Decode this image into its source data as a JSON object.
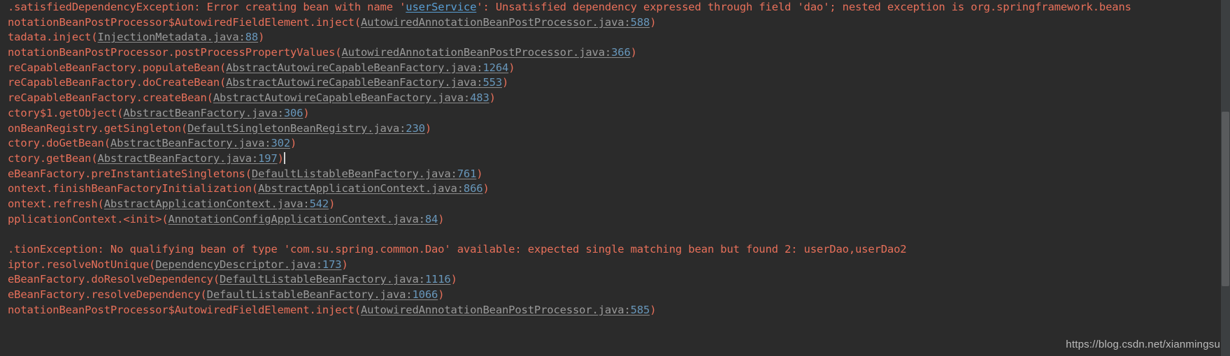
{
  "console": {
    "background_color": "#2b2b2b",
    "error_text_color": "#e8705a",
    "file_link_color": "#9a9a9a",
    "line_number_color": "#6897bb",
    "hyperlink_color": "#5a9fd4",
    "lines": [
      {
        "id": "line-1",
        "type": "exception-header",
        "segments": [
          {
            "kind": "msg",
            "text": ".satisfiedDependencyException: Error creating bean with name '"
          },
          {
            "kind": "weblink",
            "text": "userService"
          },
          {
            "kind": "msg",
            "text": "': Unsatisfied dependency expressed through field 'dao'; nested exception is org.springframework.beans"
          }
        ]
      },
      {
        "id": "line-2",
        "type": "stack-frame",
        "segments": [
          {
            "kind": "msg",
            "text": "notationBeanPostProcessor$AutowiredFieldElement.inject("
          },
          {
            "kind": "lnk",
            "text": "AutowiredAnnotationBeanPostProcessor.java:"
          },
          {
            "kind": "num",
            "text": "588"
          },
          {
            "kind": "paren",
            "text": ")"
          }
        ]
      },
      {
        "id": "line-3",
        "type": "stack-frame",
        "segments": [
          {
            "kind": "msg",
            "text": "tadata.inject("
          },
          {
            "kind": "lnk",
            "text": "InjectionMetadata.java:"
          },
          {
            "kind": "num",
            "text": "88"
          },
          {
            "kind": "paren",
            "text": ")"
          }
        ]
      },
      {
        "id": "line-4",
        "type": "stack-frame",
        "segments": [
          {
            "kind": "msg",
            "text": "notationBeanPostProcessor.postProcessPropertyValues("
          },
          {
            "kind": "lnk",
            "text": "AutowiredAnnotationBeanPostProcessor.java:"
          },
          {
            "kind": "num",
            "text": "366"
          },
          {
            "kind": "paren",
            "text": ")"
          }
        ]
      },
      {
        "id": "line-5",
        "type": "stack-frame",
        "segments": [
          {
            "kind": "msg",
            "text": "reCapableBeanFactory.populateBean("
          },
          {
            "kind": "lnk",
            "text": "AbstractAutowireCapableBeanFactory.java:"
          },
          {
            "kind": "num",
            "text": "1264"
          },
          {
            "kind": "paren",
            "text": ")"
          }
        ]
      },
      {
        "id": "line-6",
        "type": "stack-frame",
        "segments": [
          {
            "kind": "msg",
            "text": "reCapableBeanFactory.doCreateBean("
          },
          {
            "kind": "lnk",
            "text": "AbstractAutowireCapableBeanFactory.java:"
          },
          {
            "kind": "num",
            "text": "553"
          },
          {
            "kind": "paren",
            "text": ")"
          }
        ]
      },
      {
        "id": "line-7",
        "type": "stack-frame",
        "segments": [
          {
            "kind": "msg",
            "text": "reCapableBeanFactory.createBean("
          },
          {
            "kind": "lnk",
            "text": "AbstractAutowireCapableBeanFactory.java:"
          },
          {
            "kind": "num",
            "text": "483"
          },
          {
            "kind": "paren",
            "text": ")"
          }
        ]
      },
      {
        "id": "line-8",
        "type": "stack-frame",
        "segments": [
          {
            "kind": "msg",
            "text": "ctory$1.getObject("
          },
          {
            "kind": "lnk",
            "text": "AbstractBeanFactory.java:"
          },
          {
            "kind": "num",
            "text": "306"
          },
          {
            "kind": "paren",
            "text": ")"
          }
        ]
      },
      {
        "id": "line-9",
        "type": "stack-frame",
        "segments": [
          {
            "kind": "msg",
            "text": "onBeanRegistry.getSingleton("
          },
          {
            "kind": "lnk",
            "text": "DefaultSingletonBeanRegistry.java:"
          },
          {
            "kind": "num",
            "text": "230"
          },
          {
            "kind": "paren",
            "text": ")"
          }
        ]
      },
      {
        "id": "line-10",
        "type": "stack-frame",
        "segments": [
          {
            "kind": "msg",
            "text": "ctory.doGetBean("
          },
          {
            "kind": "lnk",
            "text": "AbstractBeanFactory.java:"
          },
          {
            "kind": "num",
            "text": "302"
          },
          {
            "kind": "paren",
            "text": ")"
          }
        ]
      },
      {
        "id": "line-11",
        "type": "stack-frame",
        "has_caret": true,
        "segments": [
          {
            "kind": "msg",
            "text": "ctory.getBean("
          },
          {
            "kind": "lnk",
            "text": "AbstractBeanFactory.java:"
          },
          {
            "kind": "num",
            "text": "197"
          },
          {
            "kind": "paren",
            "text": ")"
          }
        ]
      },
      {
        "id": "line-12",
        "type": "stack-frame",
        "segments": [
          {
            "kind": "msg",
            "text": "eBeanFactory.preInstantiateSingletons("
          },
          {
            "kind": "lnk",
            "text": "DefaultListableBeanFactory.java:"
          },
          {
            "kind": "num",
            "text": "761"
          },
          {
            "kind": "paren",
            "text": ")"
          }
        ]
      },
      {
        "id": "line-13",
        "type": "stack-frame",
        "segments": [
          {
            "kind": "msg",
            "text": "ontext.finishBeanFactoryInitialization("
          },
          {
            "kind": "lnk",
            "text": "AbstractApplicationContext.java:"
          },
          {
            "kind": "num",
            "text": "866"
          },
          {
            "kind": "paren",
            "text": ")"
          }
        ]
      },
      {
        "id": "line-14",
        "type": "stack-frame",
        "segments": [
          {
            "kind": "msg",
            "text": "ontext.refresh("
          },
          {
            "kind": "lnk",
            "text": "AbstractApplicationContext.java:"
          },
          {
            "kind": "num",
            "text": "542"
          },
          {
            "kind": "paren",
            "text": ")"
          }
        ]
      },
      {
        "id": "line-15",
        "type": "stack-frame",
        "segments": [
          {
            "kind": "msg",
            "text": "pplicationContext.<init>("
          },
          {
            "kind": "lnk",
            "text": "AnnotationConfigApplicationContext.java:"
          },
          {
            "kind": "num",
            "text": "84"
          },
          {
            "kind": "paren",
            "text": ")"
          }
        ]
      },
      {
        "id": "line-16",
        "type": "blank",
        "segments": [
          {
            "kind": "msg",
            "text": " "
          }
        ]
      },
      {
        "id": "line-17",
        "type": "exception-header",
        "segments": [
          {
            "kind": "msg",
            "text": ".tionException: No qualifying bean of type 'com.su.spring.common.Dao' available: expected single matching bean but found 2: userDao,userDao2"
          }
        ]
      },
      {
        "id": "line-18",
        "type": "stack-frame",
        "segments": [
          {
            "kind": "msg",
            "text": "iptor.resolveNotUnique("
          },
          {
            "kind": "lnk",
            "text": "DependencyDescriptor.java:"
          },
          {
            "kind": "num",
            "text": "173"
          },
          {
            "kind": "paren",
            "text": ")"
          }
        ]
      },
      {
        "id": "line-19",
        "type": "stack-frame",
        "segments": [
          {
            "kind": "msg",
            "text": "eBeanFactory.doResolveDependency("
          },
          {
            "kind": "lnk",
            "text": "DefaultListableBeanFactory.java:"
          },
          {
            "kind": "num",
            "text": "1116"
          },
          {
            "kind": "paren",
            "text": ")"
          }
        ]
      },
      {
        "id": "line-20",
        "type": "stack-frame",
        "segments": [
          {
            "kind": "msg",
            "text": "eBeanFactory.resolveDependency("
          },
          {
            "kind": "lnk",
            "text": "DefaultListableBeanFactory.java:"
          },
          {
            "kind": "num",
            "text": "1066"
          },
          {
            "kind": "paren",
            "text": ")"
          }
        ]
      },
      {
        "id": "line-21",
        "type": "stack-frame",
        "segments": [
          {
            "kind": "msg",
            "text": "notationBeanPostProcessor$AutowiredFieldElement.inject("
          },
          {
            "kind": "lnk",
            "text": "AutowiredAnnotationBeanPostProcessor.java:"
          },
          {
            "kind": "num",
            "text": "585"
          },
          {
            "kind": "paren",
            "text": ")"
          }
        ]
      }
    ]
  },
  "watermark": {
    "text": "https://blog.csdn.net/xianmingsu"
  }
}
